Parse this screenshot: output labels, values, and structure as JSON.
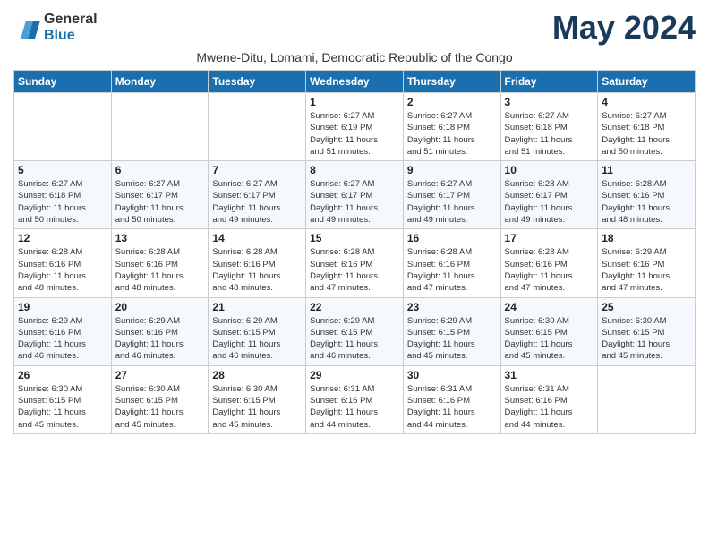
{
  "logo": {
    "text_general": "General",
    "text_blue": "Blue"
  },
  "title": "May 2024",
  "subtitle": "Mwene-Ditu, Lomami, Democratic Republic of the Congo",
  "weekdays": [
    "Sunday",
    "Monday",
    "Tuesday",
    "Wednesday",
    "Thursday",
    "Friday",
    "Saturday"
  ],
  "weeks": [
    [
      {
        "day": "",
        "info": ""
      },
      {
        "day": "",
        "info": ""
      },
      {
        "day": "",
        "info": ""
      },
      {
        "day": "1",
        "info": "Sunrise: 6:27 AM\nSunset: 6:19 PM\nDaylight: 11 hours\nand 51 minutes."
      },
      {
        "day": "2",
        "info": "Sunrise: 6:27 AM\nSunset: 6:18 PM\nDaylight: 11 hours\nand 51 minutes."
      },
      {
        "day": "3",
        "info": "Sunrise: 6:27 AM\nSunset: 6:18 PM\nDaylight: 11 hours\nand 51 minutes."
      },
      {
        "day": "4",
        "info": "Sunrise: 6:27 AM\nSunset: 6:18 PM\nDaylight: 11 hours\nand 50 minutes."
      }
    ],
    [
      {
        "day": "5",
        "info": "Sunrise: 6:27 AM\nSunset: 6:18 PM\nDaylight: 11 hours\nand 50 minutes."
      },
      {
        "day": "6",
        "info": "Sunrise: 6:27 AM\nSunset: 6:17 PM\nDaylight: 11 hours\nand 50 minutes."
      },
      {
        "day": "7",
        "info": "Sunrise: 6:27 AM\nSunset: 6:17 PM\nDaylight: 11 hours\nand 49 minutes."
      },
      {
        "day": "8",
        "info": "Sunrise: 6:27 AM\nSunset: 6:17 PM\nDaylight: 11 hours\nand 49 minutes."
      },
      {
        "day": "9",
        "info": "Sunrise: 6:27 AM\nSunset: 6:17 PM\nDaylight: 11 hours\nand 49 minutes."
      },
      {
        "day": "10",
        "info": "Sunrise: 6:28 AM\nSunset: 6:17 PM\nDaylight: 11 hours\nand 49 minutes."
      },
      {
        "day": "11",
        "info": "Sunrise: 6:28 AM\nSunset: 6:16 PM\nDaylight: 11 hours\nand 48 minutes."
      }
    ],
    [
      {
        "day": "12",
        "info": "Sunrise: 6:28 AM\nSunset: 6:16 PM\nDaylight: 11 hours\nand 48 minutes."
      },
      {
        "day": "13",
        "info": "Sunrise: 6:28 AM\nSunset: 6:16 PM\nDaylight: 11 hours\nand 48 minutes."
      },
      {
        "day": "14",
        "info": "Sunrise: 6:28 AM\nSunset: 6:16 PM\nDaylight: 11 hours\nand 48 minutes."
      },
      {
        "day": "15",
        "info": "Sunrise: 6:28 AM\nSunset: 6:16 PM\nDaylight: 11 hours\nand 47 minutes."
      },
      {
        "day": "16",
        "info": "Sunrise: 6:28 AM\nSunset: 6:16 PM\nDaylight: 11 hours\nand 47 minutes."
      },
      {
        "day": "17",
        "info": "Sunrise: 6:28 AM\nSunset: 6:16 PM\nDaylight: 11 hours\nand 47 minutes."
      },
      {
        "day": "18",
        "info": "Sunrise: 6:29 AM\nSunset: 6:16 PM\nDaylight: 11 hours\nand 47 minutes."
      }
    ],
    [
      {
        "day": "19",
        "info": "Sunrise: 6:29 AM\nSunset: 6:16 PM\nDaylight: 11 hours\nand 46 minutes."
      },
      {
        "day": "20",
        "info": "Sunrise: 6:29 AM\nSunset: 6:16 PM\nDaylight: 11 hours\nand 46 minutes."
      },
      {
        "day": "21",
        "info": "Sunrise: 6:29 AM\nSunset: 6:15 PM\nDaylight: 11 hours\nand 46 minutes."
      },
      {
        "day": "22",
        "info": "Sunrise: 6:29 AM\nSunset: 6:15 PM\nDaylight: 11 hours\nand 46 minutes."
      },
      {
        "day": "23",
        "info": "Sunrise: 6:29 AM\nSunset: 6:15 PM\nDaylight: 11 hours\nand 45 minutes."
      },
      {
        "day": "24",
        "info": "Sunrise: 6:30 AM\nSunset: 6:15 PM\nDaylight: 11 hours\nand 45 minutes."
      },
      {
        "day": "25",
        "info": "Sunrise: 6:30 AM\nSunset: 6:15 PM\nDaylight: 11 hours\nand 45 minutes."
      }
    ],
    [
      {
        "day": "26",
        "info": "Sunrise: 6:30 AM\nSunset: 6:15 PM\nDaylight: 11 hours\nand 45 minutes."
      },
      {
        "day": "27",
        "info": "Sunrise: 6:30 AM\nSunset: 6:15 PM\nDaylight: 11 hours\nand 45 minutes."
      },
      {
        "day": "28",
        "info": "Sunrise: 6:30 AM\nSunset: 6:15 PM\nDaylight: 11 hours\nand 45 minutes."
      },
      {
        "day": "29",
        "info": "Sunrise: 6:31 AM\nSunset: 6:16 PM\nDaylight: 11 hours\nand 44 minutes."
      },
      {
        "day": "30",
        "info": "Sunrise: 6:31 AM\nSunset: 6:16 PM\nDaylight: 11 hours\nand 44 minutes."
      },
      {
        "day": "31",
        "info": "Sunrise: 6:31 AM\nSunset: 6:16 PM\nDaylight: 11 hours\nand 44 minutes."
      },
      {
        "day": "",
        "info": ""
      }
    ]
  ]
}
